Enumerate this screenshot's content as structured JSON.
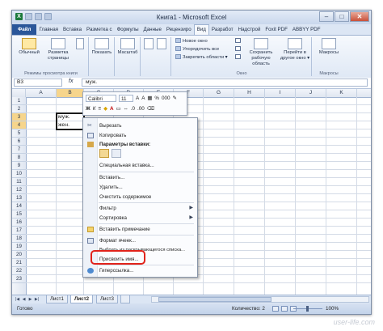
{
  "window": {
    "title": "Книга1 - Microsoft Excel"
  },
  "tabs": [
    "Файл",
    "Главная",
    "Вставка",
    "Разметка с",
    "Формулы",
    "Данные",
    "Рецензиро",
    "Вид",
    "Разработ",
    "Надстрой",
    "Foxit PDF",
    "ABBYY PDF"
  ],
  "ribbon": {
    "group1": {
      "btn1": "Обычный",
      "btn2": "Разметка страницы",
      "label": "Режимы просмотра книги"
    },
    "show": "Показать",
    "zoom": "Масштаб",
    "window_group": {
      "new_window": "Новое окно",
      "arrange": "Упорядочить все",
      "freeze": "Закрепить области",
      "save_ws": "Сохранить рабочую область",
      "switch": "Перейти в другое окно",
      "label": "Окно"
    },
    "macros": {
      "btn": "Макросы",
      "label": "Макросы"
    }
  },
  "formula_bar": {
    "name_box": "B3",
    "fx": "fx",
    "content": "муж."
  },
  "columns": [
    "A",
    "B",
    "C",
    "D",
    "E",
    "F",
    "G",
    "H",
    "I",
    "J",
    "K"
  ],
  "rows": [
    "1",
    "2",
    "3",
    "4",
    "5",
    "6",
    "7",
    "8",
    "9",
    "10",
    "11",
    "12",
    "13",
    "14",
    "15",
    "16",
    "17",
    "18",
    "19",
    "20",
    "21",
    "22",
    "23"
  ],
  "cells": {
    "b3": "муж.",
    "b4": "жен."
  },
  "mini_toolbar": {
    "font": "Calibri",
    "size": "11",
    "percent": "%",
    "bold": "Ж",
    "italic": "К",
    "align": "≡"
  },
  "context_menu": {
    "cut": "Вырезать",
    "copy": "Копировать",
    "paste_options": "Параметры вставки:",
    "paste_special": "Специальная вставка...",
    "insert": "Вставить...",
    "delete": "Удалить...",
    "clear": "Очистить содержимое",
    "filter": "Фильтр",
    "sort": "Сортировка",
    "comment": "Вставить примечание",
    "format": "Формат ячеек...",
    "dropdown": "Выбрать из раскрывающегося списка...",
    "name": "Присвоить имя...",
    "hyperlink": "Гиперссылка..."
  },
  "sheets": [
    "Лист1",
    "Лист2",
    "Лист3"
  ],
  "status": {
    "ready": "Готово",
    "count": "Количество: 2",
    "zoom": "100%"
  },
  "watermark": "user-life.com"
}
